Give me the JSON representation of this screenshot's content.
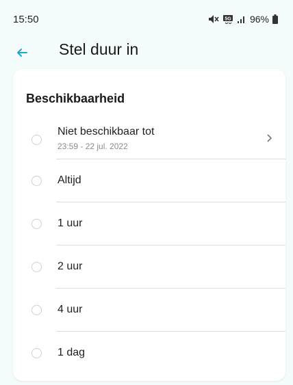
{
  "status_bar": {
    "time": "15:50",
    "network_label": "5G",
    "battery": "96%"
  },
  "header": {
    "title": "Stel duur in",
    "back_icon": "arrow-left-icon",
    "accent": "#19a6cf"
  },
  "card": {
    "section_title": "Beschikbaarheid",
    "options": [
      {
        "label": "Niet beschikbaar tot",
        "sub": "23:59 - 22 jul. 2022",
        "has_chevron": true,
        "selected": false
      },
      {
        "label": "Altijd",
        "selected": false
      },
      {
        "label": "1 uur",
        "selected": false
      },
      {
        "label": "2 uur",
        "selected": false
      },
      {
        "label": "4 uur",
        "selected": false
      },
      {
        "label": "1 dag",
        "selected": false
      }
    ]
  }
}
